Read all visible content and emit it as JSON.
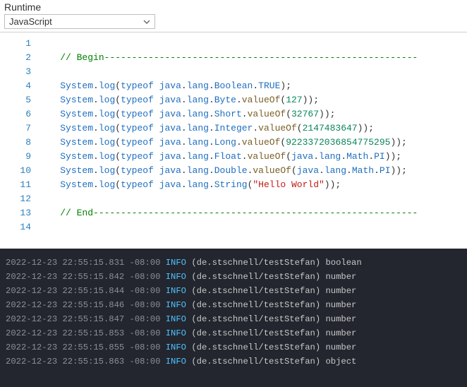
{
  "header": {
    "label": "Runtime",
    "dropdown_value": "JavaScript"
  },
  "code": {
    "lines": [
      {
        "n": 1,
        "tokens": []
      },
      {
        "n": 2,
        "tokens": [
          {
            "t": "    ",
            "c": "punct"
          },
          {
            "t": "// Begin---------------------------------------------------------",
            "c": "comment"
          }
        ]
      },
      {
        "n": 3,
        "tokens": []
      },
      {
        "n": 4,
        "tokens": [
          {
            "t": "    ",
            "c": "punct"
          },
          {
            "t": "System",
            "c": "ident"
          },
          {
            "t": ".",
            "c": "punct"
          },
          {
            "t": "log",
            "c": "ident"
          },
          {
            "t": "(",
            "c": "punct"
          },
          {
            "t": "typeof",
            "c": "keyword"
          },
          {
            "t": " ",
            "c": "punct"
          },
          {
            "t": "java",
            "c": "ident"
          },
          {
            "t": ".",
            "c": "punct"
          },
          {
            "t": "lang",
            "c": "ident"
          },
          {
            "t": ".",
            "c": "punct"
          },
          {
            "t": "Boolean",
            "c": "ident"
          },
          {
            "t": ".",
            "c": "punct"
          },
          {
            "t": "TRUE",
            "c": "enum"
          },
          {
            "t": ");",
            "c": "punct"
          }
        ]
      },
      {
        "n": 5,
        "tokens": [
          {
            "t": "    ",
            "c": "punct"
          },
          {
            "t": "System",
            "c": "ident"
          },
          {
            "t": ".",
            "c": "punct"
          },
          {
            "t": "log",
            "c": "ident"
          },
          {
            "t": "(",
            "c": "punct"
          },
          {
            "t": "typeof",
            "c": "keyword"
          },
          {
            "t": " ",
            "c": "punct"
          },
          {
            "t": "java",
            "c": "ident"
          },
          {
            "t": ".",
            "c": "punct"
          },
          {
            "t": "lang",
            "c": "ident"
          },
          {
            "t": ".",
            "c": "punct"
          },
          {
            "t": "Byte",
            "c": "ident"
          },
          {
            "t": ".",
            "c": "punct"
          },
          {
            "t": "valueOf",
            "c": "call"
          },
          {
            "t": "(",
            "c": "punct"
          },
          {
            "t": "127",
            "c": "number"
          },
          {
            "t": "));",
            "c": "punct"
          }
        ]
      },
      {
        "n": 6,
        "tokens": [
          {
            "t": "    ",
            "c": "punct"
          },
          {
            "t": "System",
            "c": "ident"
          },
          {
            "t": ".",
            "c": "punct"
          },
          {
            "t": "log",
            "c": "ident"
          },
          {
            "t": "(",
            "c": "punct"
          },
          {
            "t": "typeof",
            "c": "keyword"
          },
          {
            "t": " ",
            "c": "punct"
          },
          {
            "t": "java",
            "c": "ident"
          },
          {
            "t": ".",
            "c": "punct"
          },
          {
            "t": "lang",
            "c": "ident"
          },
          {
            "t": ".",
            "c": "punct"
          },
          {
            "t": "Short",
            "c": "ident"
          },
          {
            "t": ".",
            "c": "punct"
          },
          {
            "t": "valueOf",
            "c": "call"
          },
          {
            "t": "(",
            "c": "punct"
          },
          {
            "t": "32767",
            "c": "number"
          },
          {
            "t": "));",
            "c": "punct"
          }
        ]
      },
      {
        "n": 7,
        "tokens": [
          {
            "t": "    ",
            "c": "punct"
          },
          {
            "t": "System",
            "c": "ident"
          },
          {
            "t": ".",
            "c": "punct"
          },
          {
            "t": "log",
            "c": "ident"
          },
          {
            "t": "(",
            "c": "punct"
          },
          {
            "t": "typeof",
            "c": "keyword"
          },
          {
            "t": " ",
            "c": "punct"
          },
          {
            "t": "java",
            "c": "ident"
          },
          {
            "t": ".",
            "c": "punct"
          },
          {
            "t": "lang",
            "c": "ident"
          },
          {
            "t": ".",
            "c": "punct"
          },
          {
            "t": "Integer",
            "c": "ident"
          },
          {
            "t": ".",
            "c": "punct"
          },
          {
            "t": "valueOf",
            "c": "call"
          },
          {
            "t": "(",
            "c": "punct"
          },
          {
            "t": "2147483647",
            "c": "number"
          },
          {
            "t": "));",
            "c": "punct"
          }
        ]
      },
      {
        "n": 8,
        "tokens": [
          {
            "t": "    ",
            "c": "punct"
          },
          {
            "t": "System",
            "c": "ident"
          },
          {
            "t": ".",
            "c": "punct"
          },
          {
            "t": "log",
            "c": "ident"
          },
          {
            "t": "(",
            "c": "punct"
          },
          {
            "t": "typeof",
            "c": "keyword"
          },
          {
            "t": " ",
            "c": "punct"
          },
          {
            "t": "java",
            "c": "ident"
          },
          {
            "t": ".",
            "c": "punct"
          },
          {
            "t": "lang",
            "c": "ident"
          },
          {
            "t": ".",
            "c": "punct"
          },
          {
            "t": "Long",
            "c": "ident"
          },
          {
            "t": ".",
            "c": "punct"
          },
          {
            "t": "valueOf",
            "c": "call"
          },
          {
            "t": "(",
            "c": "punct"
          },
          {
            "t": "9223372036854775295",
            "c": "number"
          },
          {
            "t": "));",
            "c": "punct"
          }
        ]
      },
      {
        "n": 9,
        "tokens": [
          {
            "t": "    ",
            "c": "punct"
          },
          {
            "t": "System",
            "c": "ident"
          },
          {
            "t": ".",
            "c": "punct"
          },
          {
            "t": "log",
            "c": "ident"
          },
          {
            "t": "(",
            "c": "punct"
          },
          {
            "t": "typeof",
            "c": "keyword"
          },
          {
            "t": " ",
            "c": "punct"
          },
          {
            "t": "java",
            "c": "ident"
          },
          {
            "t": ".",
            "c": "punct"
          },
          {
            "t": "lang",
            "c": "ident"
          },
          {
            "t": ".",
            "c": "punct"
          },
          {
            "t": "Float",
            "c": "ident"
          },
          {
            "t": ".",
            "c": "punct"
          },
          {
            "t": "valueOf",
            "c": "call"
          },
          {
            "t": "(",
            "c": "punct"
          },
          {
            "t": "java",
            "c": "ident"
          },
          {
            "t": ".",
            "c": "punct"
          },
          {
            "t": "lang",
            "c": "ident"
          },
          {
            "t": ".",
            "c": "punct"
          },
          {
            "t": "Math",
            "c": "ident"
          },
          {
            "t": ".",
            "c": "punct"
          },
          {
            "t": "PI",
            "c": "enum"
          },
          {
            "t": "));",
            "c": "punct"
          }
        ]
      },
      {
        "n": 10,
        "tokens": [
          {
            "t": "    ",
            "c": "punct"
          },
          {
            "t": "System",
            "c": "ident"
          },
          {
            "t": ".",
            "c": "punct"
          },
          {
            "t": "log",
            "c": "ident"
          },
          {
            "t": "(",
            "c": "punct"
          },
          {
            "t": "typeof",
            "c": "keyword"
          },
          {
            "t": " ",
            "c": "punct"
          },
          {
            "t": "java",
            "c": "ident"
          },
          {
            "t": ".",
            "c": "punct"
          },
          {
            "t": "lang",
            "c": "ident"
          },
          {
            "t": ".",
            "c": "punct"
          },
          {
            "t": "Double",
            "c": "ident"
          },
          {
            "t": ".",
            "c": "punct"
          },
          {
            "t": "valueOf",
            "c": "call"
          },
          {
            "t": "(",
            "c": "punct"
          },
          {
            "t": "java",
            "c": "ident"
          },
          {
            "t": ".",
            "c": "punct"
          },
          {
            "t": "lang",
            "c": "ident"
          },
          {
            "t": ".",
            "c": "punct"
          },
          {
            "t": "Math",
            "c": "ident"
          },
          {
            "t": ".",
            "c": "punct"
          },
          {
            "t": "PI",
            "c": "enum"
          },
          {
            "t": "));",
            "c": "punct"
          }
        ]
      },
      {
        "n": 11,
        "tokens": [
          {
            "t": "    ",
            "c": "punct"
          },
          {
            "t": "System",
            "c": "ident"
          },
          {
            "t": ".",
            "c": "punct"
          },
          {
            "t": "log",
            "c": "ident"
          },
          {
            "t": "(",
            "c": "punct"
          },
          {
            "t": "typeof",
            "c": "keyword"
          },
          {
            "t": " ",
            "c": "punct"
          },
          {
            "t": "java",
            "c": "ident"
          },
          {
            "t": ".",
            "c": "punct"
          },
          {
            "t": "lang",
            "c": "ident"
          },
          {
            "t": ".",
            "c": "punct"
          },
          {
            "t": "String",
            "c": "ident"
          },
          {
            "t": "(",
            "c": "punct"
          },
          {
            "t": "\"Hello World\"",
            "c": "string"
          },
          {
            "t": "));",
            "c": "punct"
          }
        ]
      },
      {
        "n": 12,
        "tokens": []
      },
      {
        "n": 13,
        "tokens": [
          {
            "t": "    ",
            "c": "punct"
          },
          {
            "t": "// End-----------------------------------------------------------",
            "c": "comment"
          }
        ]
      },
      {
        "n": 14,
        "tokens": []
      }
    ]
  },
  "console": {
    "source": "(de.stschnell/testStefan)",
    "level": "INFO",
    "tz": "-08:00",
    "date": "2022-12-23",
    "entries": [
      {
        "time": "22:55:15.831",
        "msg": "boolean"
      },
      {
        "time": "22:55:15.842",
        "msg": "number"
      },
      {
        "time": "22:55:15.844",
        "msg": "number"
      },
      {
        "time": "22:55:15.846",
        "msg": "number"
      },
      {
        "time": "22:55:15.847",
        "msg": "number"
      },
      {
        "time": "22:55:15.853",
        "msg": "number"
      },
      {
        "time": "22:55:15.855",
        "msg": "number"
      },
      {
        "time": "22:55:15.863",
        "msg": "object"
      }
    ]
  }
}
